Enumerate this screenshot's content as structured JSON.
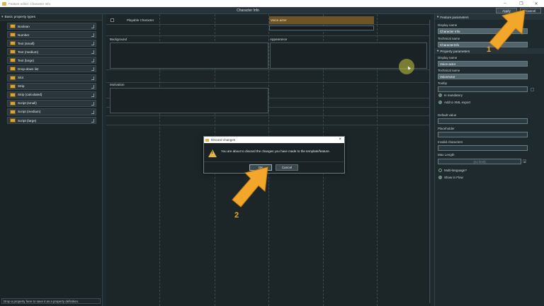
{
  "window": {
    "title": "Feature editor: Character Info"
  },
  "header": {
    "title": "Character Info",
    "apply_label": "Apply",
    "cancel_label": "Cancel"
  },
  "left_panel": {
    "heading": "Basic property types",
    "items": [
      {
        "label": "Boolean"
      },
      {
        "label": "Number"
      },
      {
        "label": "Text (small)"
      },
      {
        "label": "Text (medium)"
      },
      {
        "label": "Text (large)"
      },
      {
        "label": "Drop-down list"
      },
      {
        "label": "Slot"
      },
      {
        "label": "Strip"
      },
      {
        "label": "Strip (calculated)"
      },
      {
        "label": "Script (small)"
      },
      {
        "label": "Script (medium)"
      },
      {
        "label": "Script (large)"
      }
    ],
    "drop_hint": "Drop a property here to save it as a property definition."
  },
  "canvas": {
    "playable_label": "Playable Character",
    "voice_actor_label": "Voice actor",
    "background_label": "Background",
    "appearance_label": "Appearance",
    "motivation_label": "Motivation"
  },
  "right_panel": {
    "feature_params_title": "Feature parameters",
    "display_name_label": "Display name",
    "display_name_value": "Character Info",
    "technical_name_label": "Technical name",
    "technical_name_value": "CharacterInfo",
    "property_params_title": "Property parameters",
    "prop_display_name_label": "Display name",
    "prop_display_name_value": "Voice actor",
    "prop_technical_name_label": "Technical name",
    "prop_technical_name_value": "VoiceActor",
    "tooltip_label": "Tooltip",
    "is_mandatory_label": "Is mandatory",
    "add_xml_label": "Add to XML export",
    "default_value_label": "Default value",
    "placeholder_label": "Placeholder",
    "invalid_chars_label": "Invalid characters",
    "max_length_label": "Max Length",
    "max_length_value": "(no limit)",
    "multi_language_label": "Multi-language?",
    "show_in_flow_label": "Show in Flow"
  },
  "dialog": {
    "title": "Discard changes",
    "message": "You are about to discard the changes you have made to the template/feature.",
    "ok_label": "OK",
    "cancel_label": "Cancel"
  },
  "annotations": {
    "step1": "1",
    "step2": "2"
  },
  "colors": {
    "accent": "#f2a62a",
    "voice_actor_highlight": "#6e5528"
  }
}
